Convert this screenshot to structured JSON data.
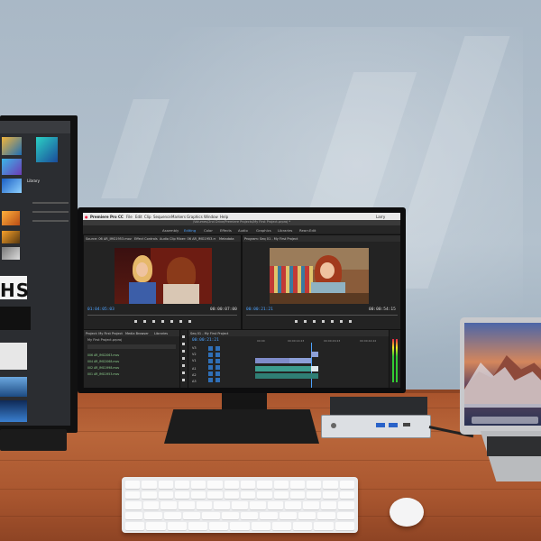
{
  "premiere": {
    "app_name": "Premiere Pro CC",
    "menu": [
      "File",
      "Edit",
      "Clip",
      "Sequence",
      "Markers",
      "Graphics",
      "Window",
      "Help"
    ],
    "user": "Larry",
    "project_path": "/Volumes/2nd Drive/Premiere Projects/My First Project.prproj *",
    "workspaces": [
      "Assembly",
      "Editing",
      "Color",
      "Effects",
      "Audio",
      "Graphics",
      "Libraries",
      "Rearr.Edit"
    ],
    "source_tabs": [
      "Source: 06 AR_IMG1953.mov",
      "Effect Controls",
      "Audio Clip Mixer: 06 AR_IMG1953.mov",
      "Metadata"
    ],
    "program_tab": "Program: Seq 01 - My First Project",
    "source_timecode": "01:04:05:03",
    "source_duration": "00:00:07:00",
    "program_timecode": "00:00:21:21",
    "program_duration": "00:00:54:15",
    "project_tabs": [
      "Project: My First Project",
      "Media Browser",
      "Libraries"
    ],
    "project_file": "My First Project.prproj",
    "project_items": [
      "006 AR_IMG2063.mov",
      "004 AR_IMG2068.mov",
      "002 AR_IMG1998.mov",
      "001 AR_IMG1953.mov"
    ],
    "timeline_tab": "Seq 01 - My First Project",
    "timeline_timecode": "00:00:21:21",
    "ruler": [
      "00:00",
      "00:00:14:23",
      "00:00:29:23",
      "00:00:44:22"
    ],
    "tracks": [
      "V3",
      "V2",
      "V1",
      "A1",
      "A2",
      "A3"
    ]
  },
  "left_monitor": {
    "big_text": "HS",
    "project_label": "Library"
  }
}
